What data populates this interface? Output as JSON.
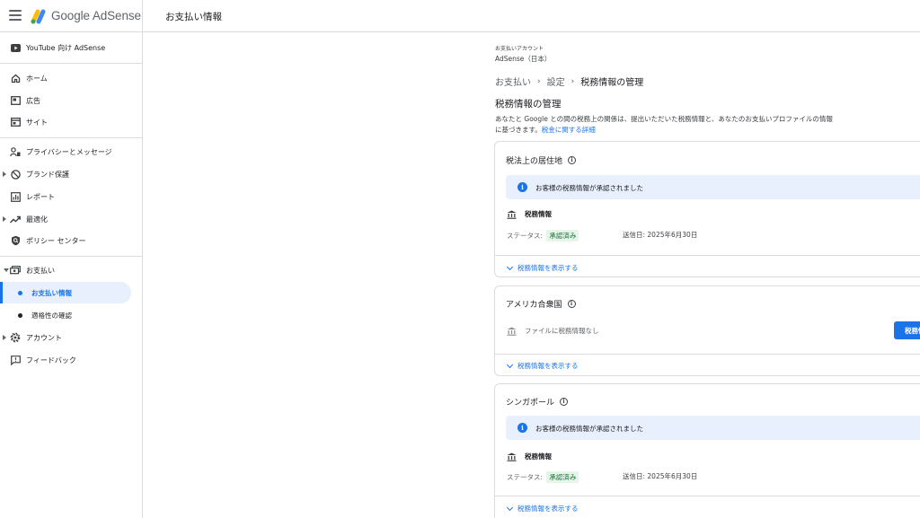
{
  "header": {
    "brand_google": "Google",
    "brand_product": "AdSense",
    "page_title": "お支払い情報"
  },
  "sidebar": {
    "youtube": "YouTube 向け AdSense",
    "items": {
      "home": "ホーム",
      "ads": "広告",
      "sites": "サイト",
      "privacy": "プライバシーとメッセージ",
      "brand": "ブランド保護",
      "reports": "レポート",
      "optimize": "最適化",
      "policy": "ポリシー センター",
      "payments": "お支払い",
      "payments_info": "お支払い情報",
      "eligibility": "適格性の確認",
      "account": "アカウント",
      "feedback": "フィードバック"
    }
  },
  "main": {
    "account_label": "お支払いアカウント",
    "account_name": "AdSense（日本）",
    "breadcrumb": [
      "お支払い",
      "設定",
      "税務情報の管理"
    ],
    "title": "税務情報の管理",
    "description": "あなたと Google との間の税務上の関係は、提出いただいた税務情報と、あなたのお支払いプロファイルの情報に基づきます。",
    "description_link": "税金に関する詳細",
    "cards": [
      {
        "title": "税法上の居住地",
        "banner": "お客様の税務情報が承認されました",
        "subhead": "税務情報",
        "status_label": "ステータス:",
        "status_value": "承認済み",
        "sent": "送信日: 2025年6月30日",
        "expand": "税務情報を表示する"
      },
      {
        "title": "アメリカ合衆国",
        "nofile": "ファイルに税務情報なし",
        "button": "税務情報",
        "expand": "税務情報を表示する"
      },
      {
        "title": "シンガポール",
        "banner": "お客様の税務情報が承認されました",
        "subhead": "税務情報",
        "status_label": "ステータス:",
        "status_value": "承認済み",
        "sent": "送信日: 2025年6月30日",
        "expand": "税務情報を表示する"
      }
    ]
  },
  "colors": {
    "accent": "#1a73e8",
    "banner_bg": "#e8f0fe",
    "approved_bg": "#e6f4ea",
    "approved_text": "#137333"
  }
}
